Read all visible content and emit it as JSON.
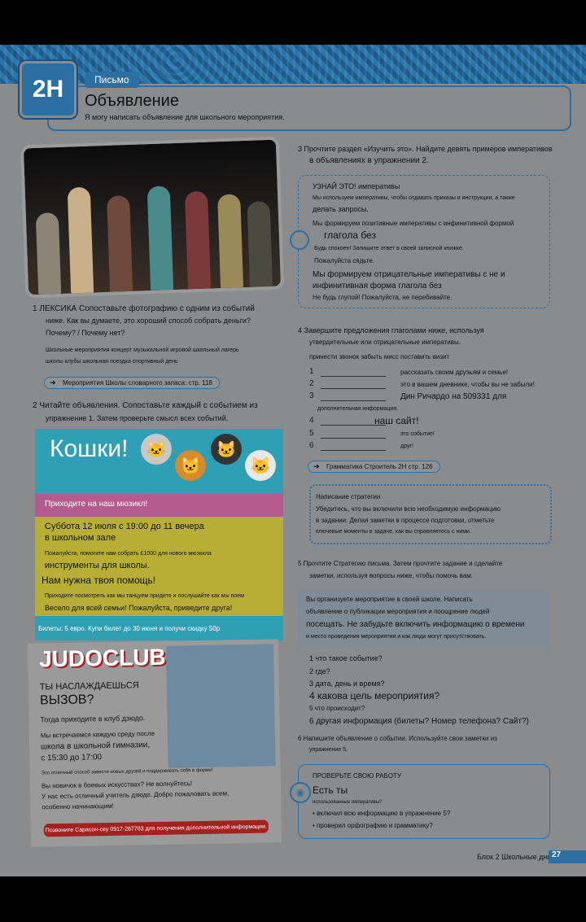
{
  "unit": "2H",
  "tag": "Письмо",
  "title": "Объявление",
  "subtitle": "Я могу написать объявление для школьного мероприятия.",
  "ex1": {
    "heading": "1 ЛЕКСИКА Сопоставьте фотографию с одним из событий",
    "line2": "ниже. Как вы думаете, это хороший способ собрать деньги?",
    "line3": "Почему? / Почему нет?",
    "events1": "Школьные мероприятия концерт музыкальной игровой школьный лагерь",
    "events2": "школы клубы школьная поездка спортивный день",
    "ref": "Мероприятия Школы словарного запаса: стр. 118"
  },
  "ex2": {
    "line1": "2 Читайте объявления. Сопоставьте каждый с событием из",
    "line2": "упражнение 1. Затем проверьте смысл всех событий."
  },
  "cats": {
    "title": "Кошки!",
    "musical": "Приходите на наш мюзикл!",
    "date": "Суббота 12 июля с 19:00 до 11 вечера",
    "place": "в школьном зале",
    "help": "Пожалуйста, помогите нам собрать £1000 для нового мюзикла",
    "instr": "инструменты для школы.",
    "need": "Нам нужна твоя помощь!",
    "sing": "Приходите посмотреть как мы танцуем придите и послушайте как мы поем",
    "fun": "Весело для всей семьи! Пожалуйста, приведите друга!",
    "tickets": "Билеты: 5 евро. Купи билет до 30 июня и получи скидку 50р"
  },
  "judo": {
    "title": "JUDOCLUB",
    "q1": "ТЫ НАСЛАЖДАЕШЬСЯ",
    "q2": "ВЫЗОВ?",
    "come": "Тогда приходите в клуб дзюдо.",
    "meet": "Мы встречаемся каждую среду после",
    "school": "школа в школьной гимназии,",
    "time": "с 15:30 до 17:00",
    "fit": "Это отличный способ завести новых друзей и поддерживать себя в форме!",
    "new": "Вы новичок в боевых искусствах? Не волнуйтесь!",
    "teacher": "У нас есть отличный учитель дзюдо. Добро пожаловать всем,",
    "beginners": "особенно начинающим!",
    "contact": "Позвоните Сарасон-сеу 0917-267783 для получения дополнительной информации."
  },
  "ex3": {
    "line1": "3 Прочтите раздел «Изучить это». Найдите девять примеров императивов",
    "line2": "в объявлениях в упражнении 2."
  },
  "know": {
    "head": "УЗНАЙ ЭТО! императивы",
    "p1": "Мы используем императивы, чтобы отдавать приказы и инструкции, а также",
    "p1b": "делать запросы.",
    "p2": "Мы формируем позитивные императивы с инфинитивной формой",
    "p2b": "глагола без",
    "p3": "Будь спокоен! Запишите ответ в своей записной книжке.",
    "p4": "Пожалуйста сядьте.",
    "p5": "Мы формируем отрицательные императивы с не и",
    "p5b": "инфинитивная форма глагола без",
    "p6": "Не будь глупой! Пожалуйста, не перебивайте."
  },
  "ex4": {
    "line1": "4 Завершите предложения глаголами ниже, используя",
    "line2": "утвердительные или отрицательные императивы.",
    "verbs": "принести звонок забыть мисс поставить визит",
    "items": [
      {
        "n": "1",
        "t": "рассказать своим друзьям и семье!"
      },
      {
        "n": "2",
        "t": "это в вашем дневнике, чтобы вы не забыли!"
      },
      {
        "n": "3",
        "t": "Дин Ричардо на 509331 для"
      },
      {
        "n": "",
        "t": "дополнительная информация."
      },
      {
        "n": "4",
        "t": "наш сайт!"
      },
      {
        "n": "5",
        "t": "это событие!"
      },
      {
        "n": "6",
        "t": "друг!"
      }
    ],
    "ref": "Грамматика Строитель 2H стр. 126"
  },
  "strategy": {
    "head": "Написание стратегии",
    "l1": "Убедитесь, что вы включили всю необходимую информацию",
    "l2": "в задании. Делая заметки в процессе подготовки, отметьте",
    "l3": "ключевые моменты в задаче, как вы справляетесь с ними."
  },
  "ex5": {
    "line1": "5 Прочтите Стратегию письма. Затем прочтите задание и сделайте",
    "line2": "заметки, используя вопросы ниже, чтобы помочь вам."
  },
  "task": {
    "l1": "Вы организуете мероприятие в своей школе. Написать",
    "l2": "объявление о публикации мероприятия и поощрение людей",
    "l3": "посещать. Не забудьте включить информацию о времени",
    "l4": "и место проведения мероприятия и как люди могут присутствовать."
  },
  "questions": [
    "1 что такое событие?",
    "2 где?",
    "3 дата, день и время?",
    "4 какова цель мероприятия?",
    "5 что происходит?",
    "6 другая информация (билеты? Номер телефона? Сайт?)"
  ],
  "ex6": {
    "line1": "6 Напишите объявление о событии. Используйте свои заметки из",
    "line2": "упражнение 5."
  },
  "check": {
    "head": "ПРОВЕРЬТЕ СВОЮ РАБОТУ",
    "have": "Есть ты",
    "b1": "использованные императивы?",
    "b2": "включил всю информацию в упражнение 5?",
    "b3": "проверил орфографию и грамматику?"
  },
  "footer": "Блок 2 Школьные дни",
  "page": "27"
}
